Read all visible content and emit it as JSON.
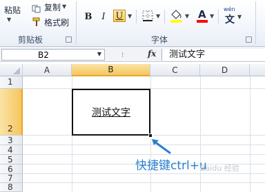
{
  "ribbon": {
    "paste_label": "粘贴",
    "copy_label": "复制",
    "format_painter_label": "格式刷",
    "clipboard_group": "剪贴板",
    "font_group": "字体",
    "bold": "B",
    "italic": "I",
    "underline": "U",
    "phonetic": "wén",
    "highlight_color": "#ffff00",
    "font_color": "#ff0000"
  },
  "formula_bar": {
    "name_box": "B2",
    "fx": "fx",
    "formula": "测试文字"
  },
  "sheet": {
    "columns": [
      "A",
      "B",
      "C",
      "D"
    ],
    "rows": [
      "1",
      "2",
      "3",
      "4",
      "5",
      "6",
      "7",
      "8"
    ],
    "selected_column": "B",
    "selected_row": "2",
    "cell_B2": "测试文字"
  },
  "annotation": {
    "caption": "快捷键ctrl+u",
    "arrow_color": "#2a7fd0"
  }
}
